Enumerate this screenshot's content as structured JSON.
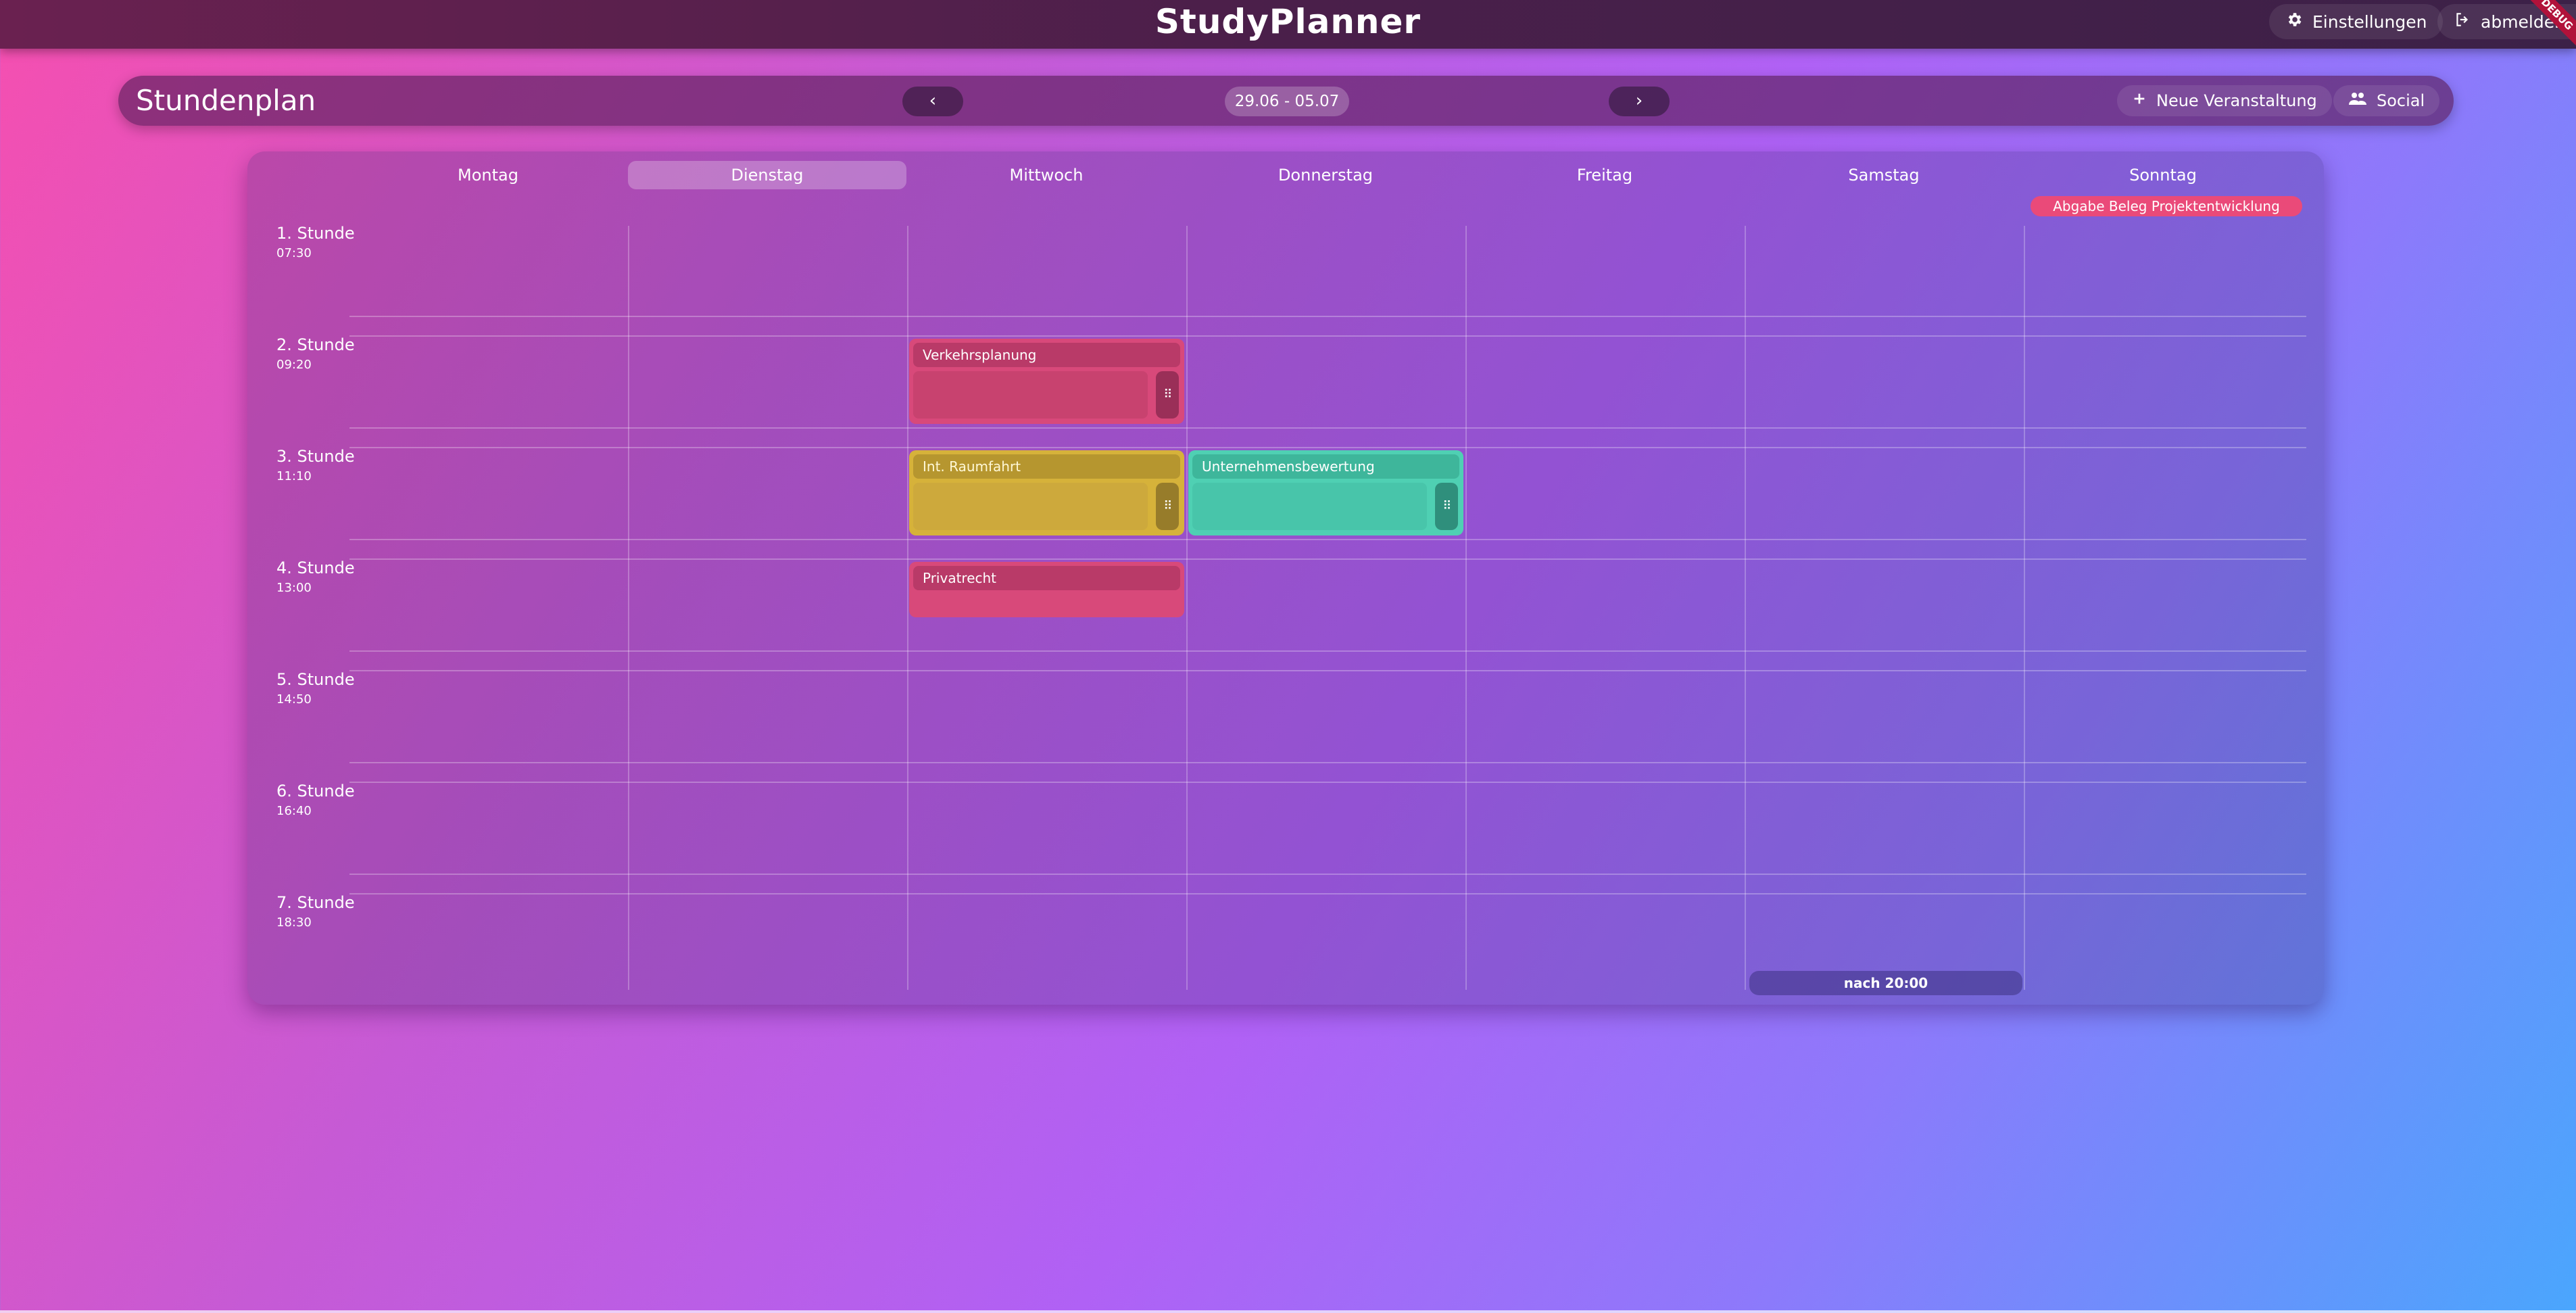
{
  "app": {
    "brand": "StudyPlanner",
    "settings_label": "Einstellungen",
    "logout_label": "abmelden",
    "debug_label": "DEBUG"
  },
  "toolbar": {
    "title": "Stundenplan",
    "prev_label": "‹",
    "next_label": "›",
    "date_range": "29.06 - 05.07",
    "new_event_label": "Neue Veranstaltung",
    "social_label": "Social"
  },
  "week": {
    "days": [
      "Montag",
      "Dienstag",
      "Mittwoch",
      "Donnerstag",
      "Freitag",
      "Samstag",
      "Sonntag"
    ],
    "active_day": "Dienstag",
    "slots": [
      {
        "name": "1. Stunde",
        "time": "07:30"
      },
      {
        "name": "2. Stunde",
        "time": "09:20"
      },
      {
        "name": "3. Stunde",
        "time": "11:10"
      },
      {
        "name": "4. Stunde",
        "time": "13:00"
      },
      {
        "name": "5. Stunde",
        "time": "14:50"
      },
      {
        "name": "6. Stunde",
        "time": "16:40"
      },
      {
        "name": "7. Stunde",
        "time": "18:30"
      }
    ],
    "all_day_event": {
      "day": "Sonntag",
      "title": "Abgabe Beleg Projektentwicklung",
      "color": "#ea4a79"
    },
    "events": [
      {
        "title": "Verkehrsplanung",
        "day": "Mittwoch",
        "slot": "2. Stunde",
        "color": "#d8497a",
        "has_handle": true
      },
      {
        "title": "Int. Raumfahrt",
        "day": "Mittwoch",
        "slot": "3. Stunde",
        "color": "#d6b23a",
        "has_handle": true
      },
      {
        "title": "Unternehmensbewertung",
        "day": "Donnerstag",
        "slot": "3. Stunde",
        "color": "#4fd0b3",
        "has_handle": true
      },
      {
        "title": "Privatrecht",
        "day": "Mittwoch",
        "slot": "4. Stunde",
        "color": "#d8497a",
        "has_handle": false
      }
    ],
    "after_label": "nach 20:00"
  },
  "icons": {
    "settings": "gear-icon",
    "logout": "logout-icon",
    "new_event": "plus-icon",
    "social": "people-icon",
    "drag": "drag-handle-icon"
  }
}
